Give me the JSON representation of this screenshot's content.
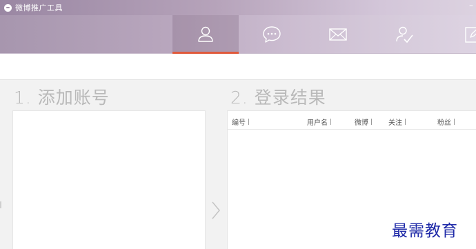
{
  "window": {
    "title": "微博推广工具",
    "minimize_glyph": "–"
  },
  "toolbar": {
    "tabs": [
      {
        "icon": "user-icon",
        "active": true
      },
      {
        "icon": "chat-bubble-icon",
        "active": false
      },
      {
        "icon": "mail-icon",
        "active": false
      },
      {
        "icon": "user-check-icon",
        "active": false
      },
      {
        "icon": "edit-icon",
        "active": false
      }
    ]
  },
  "sections": {
    "add_accounts": {
      "title": "1. 添加账号"
    },
    "login_results": {
      "title": "2. 登录结果"
    }
  },
  "results_table": {
    "columns": [
      "编号",
      "用户名",
      "微博",
      "关注",
      "粉丝"
    ]
  },
  "watermark": "最需教育",
  "colors": {
    "active_tab_indicator": "#e05a3c",
    "section_title": "#b9b9b9",
    "watermark": "#1f2aa8"
  }
}
